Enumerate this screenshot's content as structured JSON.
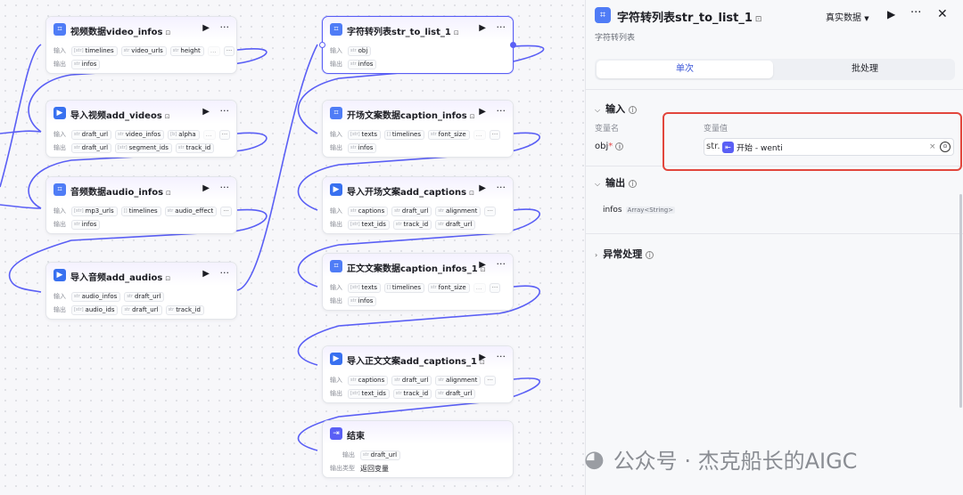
{
  "canvas": {
    "input_label": "输入",
    "output_label": "输出",
    "nodes": [
      {
        "id": "n1",
        "title": "视频数据video_infos",
        "icon": "code",
        "in": [
          {
            "t": "[str]",
            "v": "timelines"
          },
          {
            "t": "str",
            "v": "video_urls"
          },
          {
            "t": "str",
            "v": "height"
          }
        ],
        "out": [
          {
            "t": "str",
            "v": "infos"
          }
        ]
      },
      {
        "id": "n2",
        "title": "导入视频add_videos",
        "icon": "play",
        "in": [
          {
            "t": "str",
            "v": "draft_url"
          },
          {
            "t": "str",
            "v": "video_infos"
          },
          {
            "t": "[b]",
            "v": "alpha"
          }
        ],
        "out": [
          {
            "t": "str",
            "v": "draft_url"
          },
          {
            "t": "[str]",
            "v": "segment_ids"
          },
          {
            "t": "str",
            "v": "track_id"
          }
        ]
      },
      {
        "id": "n3",
        "title": "音频数据audio_infos",
        "icon": "code",
        "in": [
          {
            "t": "[str]",
            "v": "mp3_urls"
          },
          {
            "t": "[]",
            "v": "timelines"
          },
          {
            "t": "str",
            "v": "audio_effect"
          }
        ],
        "out": [
          {
            "t": "str",
            "v": "infos"
          }
        ]
      },
      {
        "id": "n4",
        "title": "导入音频add_audios",
        "icon": "play",
        "in": [
          {
            "t": "str",
            "v": "audio_infos"
          },
          {
            "t": "str",
            "v": "draft_url"
          }
        ],
        "out": [
          {
            "t": "[str]",
            "v": "audio_ids"
          },
          {
            "t": "str",
            "v": "draft_url"
          },
          {
            "t": "str",
            "v": "track_id"
          }
        ]
      },
      {
        "id": "n5",
        "title": "字符转列表str_to_list_1",
        "icon": "code",
        "in": [
          {
            "t": "str",
            "v": "obj"
          }
        ],
        "out": [
          {
            "t": "str",
            "v": "infos"
          }
        ]
      },
      {
        "id": "n6",
        "title": "开场文案数据caption_infos",
        "icon": "code",
        "in": [
          {
            "t": "[str]",
            "v": "texts"
          },
          {
            "t": "[]",
            "v": "timelines"
          },
          {
            "t": "str",
            "v": "font_size"
          }
        ],
        "out": [
          {
            "t": "str",
            "v": "infos"
          }
        ]
      },
      {
        "id": "n7",
        "title": "导入开场文案add_captions",
        "icon": "play",
        "in": [
          {
            "t": "str",
            "v": "captions"
          },
          {
            "t": "str",
            "v": "draft_url"
          },
          {
            "t": "str",
            "v": "alignment"
          }
        ],
        "out": [
          {
            "t": "[str]",
            "v": "text_ids"
          },
          {
            "t": "str",
            "v": "track_id"
          },
          {
            "t": "str",
            "v": "draft_url"
          }
        ]
      },
      {
        "id": "n8",
        "title": "正文文案数据caption_infos_1",
        "icon": "code",
        "in": [
          {
            "t": "[str]",
            "v": "texts"
          },
          {
            "t": "[]",
            "v": "timelines"
          },
          {
            "t": "str",
            "v": "font_size"
          }
        ],
        "out": [
          {
            "t": "str",
            "v": "infos"
          }
        ]
      },
      {
        "id": "n9",
        "title": "导入正文文案add_captions_1",
        "icon": "play",
        "in": [
          {
            "t": "str",
            "v": "captions"
          },
          {
            "t": "str",
            "v": "draft_url"
          },
          {
            "t": "str",
            "v": "alignment"
          }
        ],
        "out": [
          {
            "t": "[str]",
            "v": "text_ids"
          },
          {
            "t": "str",
            "v": "track_id"
          },
          {
            "t": "str",
            "v": "draft_url"
          }
        ]
      },
      {
        "id": "n10",
        "title": "结束",
        "icon": "end",
        "out": [
          {
            "t": "str",
            "v": "draft_url"
          }
        ],
        "out_type_label": "输出类型",
        "out_type": "返回变量"
      }
    ]
  },
  "panel": {
    "title": "字符转列表str_to_list_1",
    "data_mode": "真实数据",
    "description": "字符转列表",
    "tabs": [
      "单次",
      "批处理"
    ],
    "input_section": "输入",
    "col_name": "变量名",
    "col_value": "变量值",
    "var_name": "obj",
    "var_required": "*",
    "var_type": "str.",
    "var_ref": "开始 - wenti",
    "output_section": "输出",
    "output_name": "infos",
    "output_type": "Array<String>",
    "error_section": "异常处理"
  },
  "watermark": "公众号 · 杰克船长的AIGC",
  "colors": {
    "accent": "#5a5ff5",
    "highlight": "#e2463c"
  }
}
